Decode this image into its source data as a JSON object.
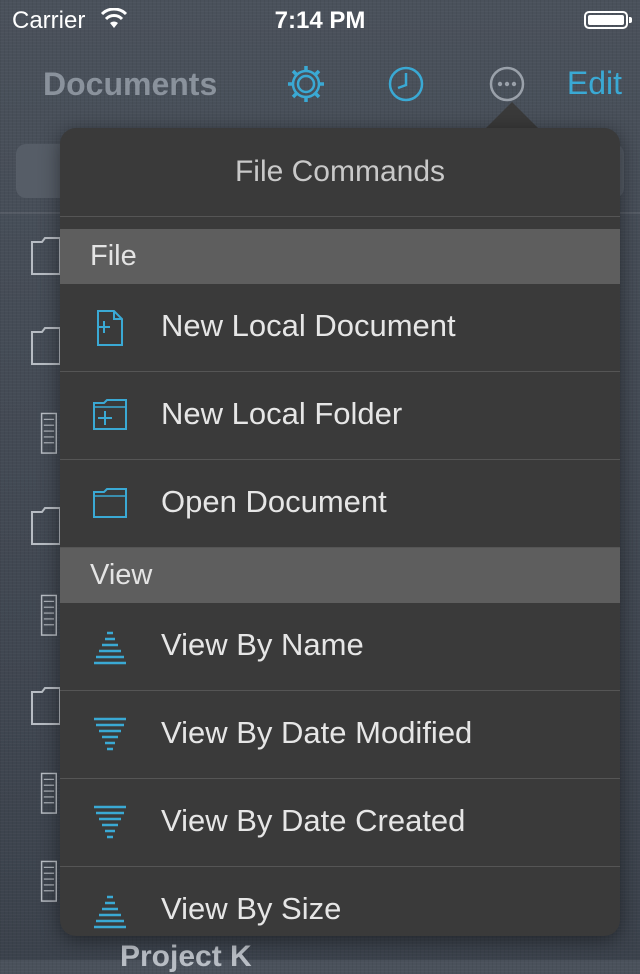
{
  "status_bar": {
    "carrier": "Carrier",
    "time": "7:14 PM"
  },
  "nav": {
    "title": "Documents",
    "edit_label": "Edit",
    "icons": [
      "settings-gear-icon",
      "clock-history-icon",
      "more-ellipsis-icon"
    ]
  },
  "background_list": {
    "peek_text": "Project K"
  },
  "popover": {
    "title": "File Commands",
    "sections": [
      {
        "header": "File",
        "items": [
          {
            "label": "New Local Document",
            "icon": "new-document-icon"
          },
          {
            "label": "New Local Folder",
            "icon": "new-folder-icon"
          },
          {
            "label": "Open Document",
            "icon": "folder-icon"
          }
        ]
      },
      {
        "header": "View",
        "items": [
          {
            "label": "View By Name",
            "icon": "sort-ascending-icon"
          },
          {
            "label": "View By Date Modified",
            "icon": "sort-descending-icon"
          },
          {
            "label": "View By Date Created",
            "icon": "sort-descending-icon"
          },
          {
            "label": "View By Size",
            "icon": "sort-ascending-icon"
          }
        ]
      }
    ]
  },
  "colors": {
    "accent": "#3aa9d4",
    "popover_bg": "#3a3a3a",
    "section_header_bg": "#5e5e5e"
  }
}
